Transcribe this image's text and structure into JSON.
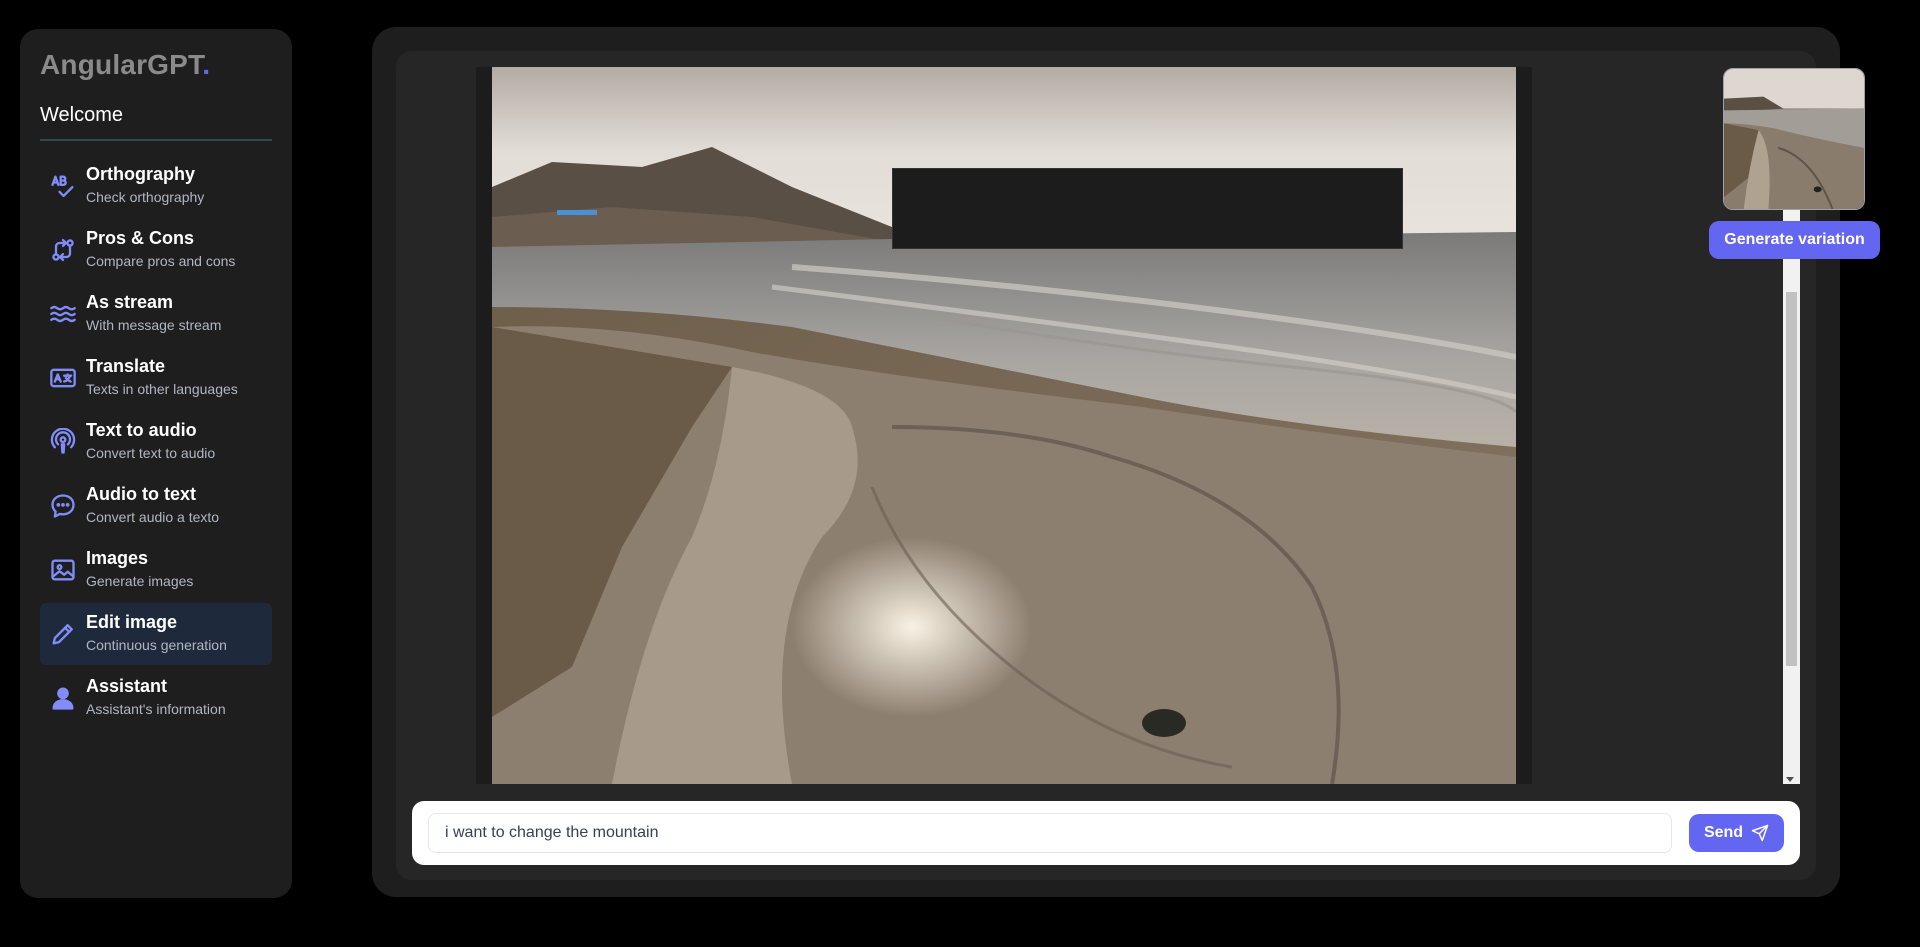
{
  "sidebar": {
    "brand": "AngularGPT",
    "brand_dot": ".",
    "welcome": "Welcome",
    "items": [
      {
        "title": "Orthography",
        "subtitle": "Check orthography",
        "icon": "spellcheck-icon"
      },
      {
        "title": "Pros & Cons",
        "subtitle": "Compare pros and cons",
        "icon": "compare-arrows-icon"
      },
      {
        "title": "As stream",
        "subtitle": "With message stream",
        "icon": "waves-icon"
      },
      {
        "title": "Translate",
        "subtitle": "Texts in other languages",
        "icon": "translate-icon"
      },
      {
        "title": "Text to audio",
        "subtitle": "Convert text to audio",
        "icon": "podcast-icon"
      },
      {
        "title": "Audio to text",
        "subtitle": "Convert audio a texto",
        "icon": "chat-bubble-icon"
      },
      {
        "title": "Images",
        "subtitle": "Generate images",
        "icon": "image-icon"
      },
      {
        "title": "Edit image",
        "subtitle": "Continuous generation",
        "icon": "pencil-icon",
        "active": true
      },
      {
        "title": "Assistant",
        "subtitle": "Assistant's information",
        "icon": "user-icon"
      }
    ]
  },
  "main": {
    "variation_label": "Generate variation",
    "input": {
      "value": "i want to change the mountain",
      "placeholder": ""
    },
    "send_label": "Send"
  },
  "colors": {
    "accent": "#6366f1",
    "icon": "#818cf8",
    "active_item": "#1e293b",
    "panel": "#1e1e1e"
  }
}
